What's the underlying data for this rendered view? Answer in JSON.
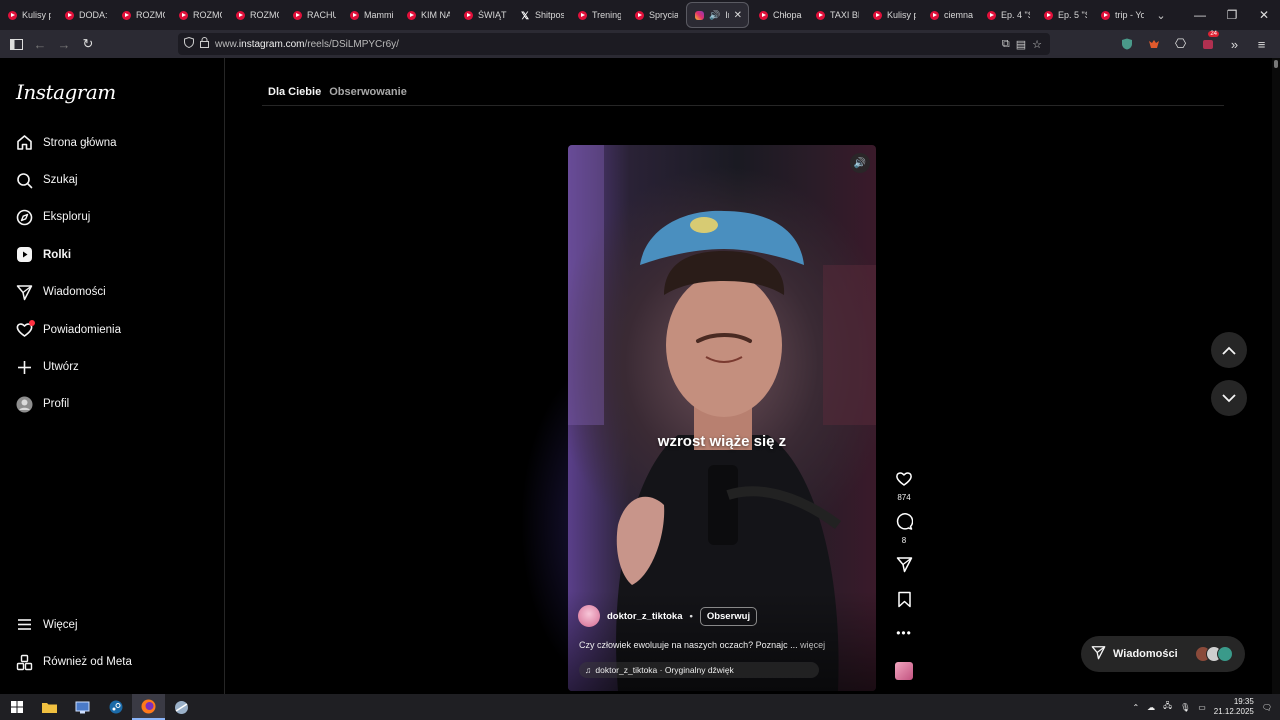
{
  "browser": {
    "tabs": [
      {
        "label": "Kulisy p",
        "icon": "youtube-icon"
      },
      {
        "label": "DODA:",
        "icon": "youtube-icon"
      },
      {
        "label": "ROZMO",
        "icon": "youtube-icon"
      },
      {
        "label": "ROZMO",
        "icon": "youtube-icon"
      },
      {
        "label": "ROZMO",
        "icon": "youtube-icon"
      },
      {
        "label": "RACHU",
        "icon": "youtube-icon"
      },
      {
        "label": "Mammi",
        "icon": "youtube-icon"
      },
      {
        "label": "KIM NA",
        "icon": "youtube-icon"
      },
      {
        "label": "ŚWIĄTE",
        "icon": "youtube-icon"
      },
      {
        "label": "Shitpos",
        "icon": "x-icon"
      },
      {
        "label": "Trening",
        "icon": "youtube-icon"
      },
      {
        "label": "Spryciar",
        "icon": "youtube-icon"
      },
      {
        "label": "Insta",
        "icon": "instagram-icon",
        "active": true
      },
      {
        "label": "Chłopak",
        "icon": "youtube-icon"
      },
      {
        "label": "TAXI BE",
        "icon": "youtube-icon"
      },
      {
        "label": "Kulisy p",
        "icon": "youtube-icon"
      },
      {
        "label": "ciemna",
        "icon": "youtube-icon"
      },
      {
        "label": "Ep. 4 \"S",
        "icon": "youtube-icon"
      },
      {
        "label": "Ep. 5 \"S",
        "icon": "youtube-icon"
      },
      {
        "label": "trip - Yo",
        "icon": "youtube-icon"
      }
    ],
    "url_prefix": "www.",
    "url_domain": "instagram.com",
    "url_path": "/reels/DSiLMPYCr6y/",
    "extension_badge": "24"
  },
  "sidebar": {
    "logo": "Instagram",
    "items": [
      {
        "label": "Strona główna",
        "icon": "home-icon"
      },
      {
        "label": "Szukaj",
        "icon": "search-icon"
      },
      {
        "label": "Eksploruj",
        "icon": "compass-icon"
      },
      {
        "label": "Rolki",
        "icon": "reels-icon"
      },
      {
        "label": "Wiadomości",
        "icon": "send-icon"
      },
      {
        "label": "Powiadomienia",
        "icon": "heart-icon"
      },
      {
        "label": "Utwórz",
        "icon": "plus-icon"
      },
      {
        "label": "Profil",
        "icon": "profile-icon"
      }
    ],
    "bottom": [
      {
        "label": "Więcej",
        "icon": "menu-icon"
      },
      {
        "label": "Również od Meta",
        "icon": "meta-icon"
      }
    ]
  },
  "feed_tabs": {
    "for_you": "Dla Ciebie",
    "following": "Obserwowanie"
  },
  "reel": {
    "overlay_caption": "wzrost wiąże się z",
    "author": "doktor_z_tiktoka",
    "separator": "•",
    "follow_label": "Obserwuj",
    "description": "Czy człowiek ewoluuje na naszych oczach? Poznajc ...",
    "more_label": "więcej",
    "audio": "doktor_z_tiktoka · Oryginalny dźwięk",
    "likes": "874",
    "comments": "8"
  },
  "messages_pill": {
    "label": "Wiadomości"
  },
  "taskbar": {
    "time": "19:35",
    "date": "21.12.2025"
  },
  "colors": {
    "instagram_bg": "#000000",
    "notification": "#ff3040",
    "youtube_red": "#e0103a"
  }
}
